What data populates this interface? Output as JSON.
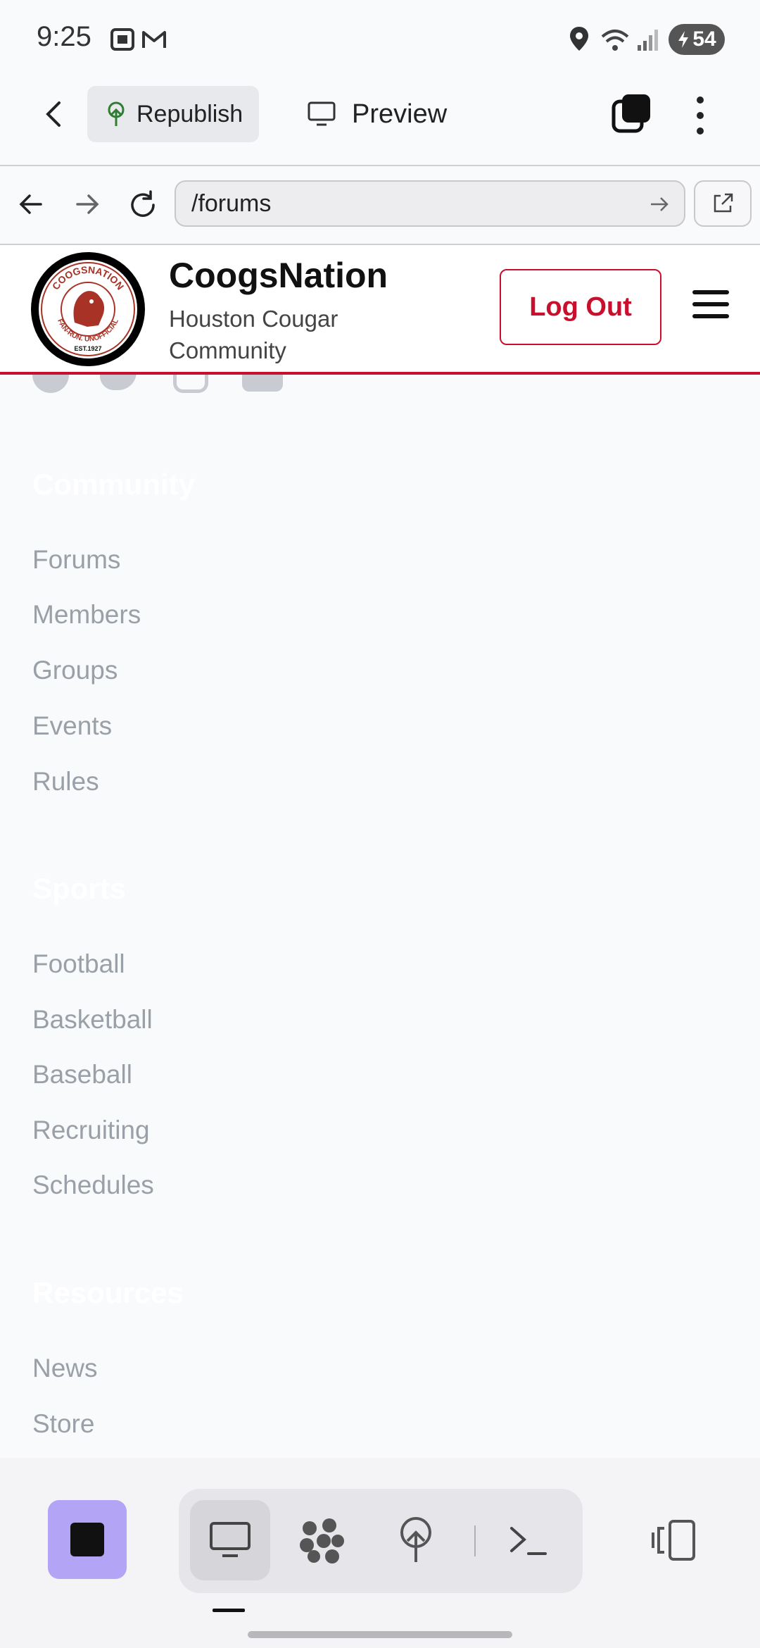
{
  "status_bar": {
    "time": "9:25",
    "battery": "54"
  },
  "app_toolbar": {
    "republish_label": "Republish",
    "preview_label": "Preview"
  },
  "url_bar": {
    "url": "/forums"
  },
  "site_header": {
    "site_name": "CoogsNation",
    "tagline": "Houston Cougar Community",
    "logout_label": "Log Out",
    "logo_text_top": "COOGSNATION",
    "logo_text_bottom": "FAN-RUN. UNOFFICIAL",
    "logo_est": "EST.1927"
  },
  "footer": {
    "community": {
      "title": "Community",
      "links": [
        "Forums",
        "Members",
        "Groups",
        "Events",
        "Rules"
      ]
    },
    "sports": {
      "title": "Sports",
      "links": [
        "Football",
        "Basketball",
        "Baseball",
        "Recruiting",
        "Schedules"
      ]
    },
    "resources": {
      "title": "Resources",
      "links": [
        "News",
        "Store"
      ]
    }
  },
  "colors": {
    "brand_red": "#c8102e",
    "link_gray": "#9aa0a8",
    "stop_purple": "#b3a4f6"
  }
}
